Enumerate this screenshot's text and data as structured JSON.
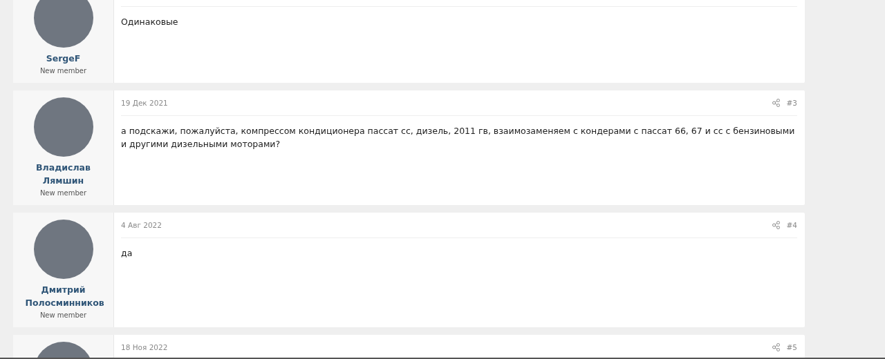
{
  "posts": [
    {
      "author": "SergeF",
      "role": "New member",
      "message": "Одинаковые"
    },
    {
      "author": "Владислав Лямшин",
      "role": "New member",
      "date": "19 Дек 2021",
      "number": "#3",
      "message": "а подскажи, пожалуйста, компрессом кондиционера пассат сс, дизель, 2011 гв, взаимозаменяем с кондерами с пассат 66, 67 и сс с бензиновыми и другими дизельными моторами?"
    },
    {
      "author": "Дмитрий Полосминников",
      "role": "New member",
      "date": "4 Авг 2022",
      "number": "#4",
      "message": "да"
    },
    {
      "date": "18 Ноя 2022",
      "number": "#5"
    }
  ]
}
